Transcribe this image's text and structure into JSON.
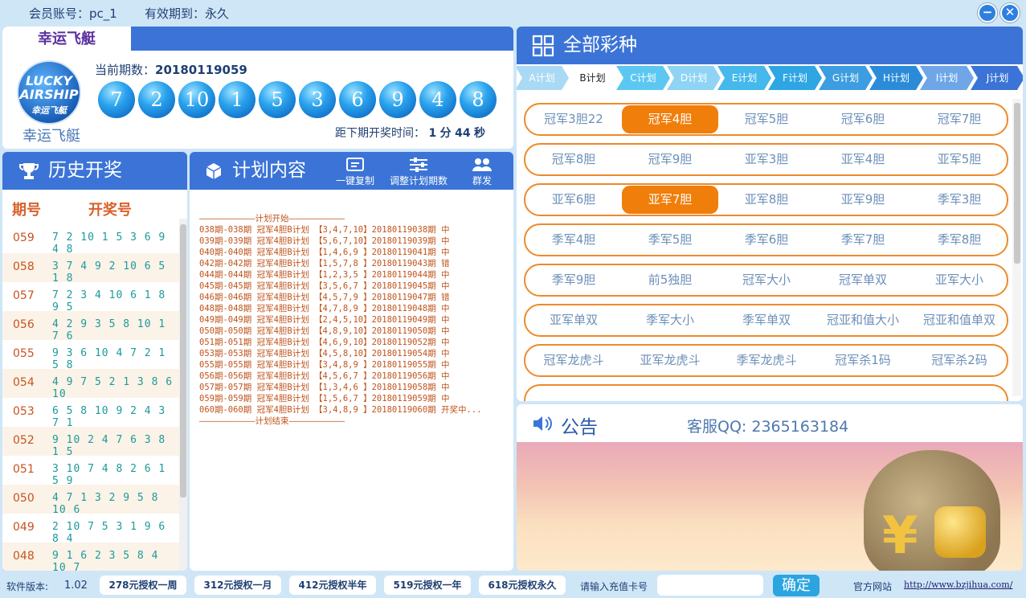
{
  "window": {
    "account_label": "会员账号：pc_1",
    "expiry_label": "有效期到：永久",
    "minimize": "−",
    "close": "✕"
  },
  "lottery": {
    "tab": "幸运飞艇",
    "logo_line1": "LUCKY",
    "logo_line2": "AIRSHIP",
    "logo_line3": "幸运飞艇",
    "logo_caption": "幸运飞艇",
    "period_label": "当前期数：",
    "period_value": "20180119059",
    "balls": [
      "7",
      "2",
      "10",
      "1",
      "5",
      "3",
      "6",
      "9",
      "4",
      "8"
    ],
    "countdown_label": "距下期开奖时间：",
    "countdown_min": "1",
    "countdown_min_unit": "分",
    "countdown_sec": "44",
    "countdown_sec_unit": "秒"
  },
  "history": {
    "title": "历史开奖",
    "col_period": "期号",
    "col_numbers": "开奖号",
    "rows": [
      {
        "period": "059",
        "numbers": "7 2 10 1 5 3 6 9 4 8"
      },
      {
        "period": "058",
        "numbers": "3 7 4 9 2 10 6 5 1 8"
      },
      {
        "period": "057",
        "numbers": "7 2 3 4 10 6 1 8 9 5"
      },
      {
        "period": "056",
        "numbers": "4 2 9 3 5 8 10 1 7 6"
      },
      {
        "period": "055",
        "numbers": "9 3 6 10 4 7 2 1 5 8"
      },
      {
        "period": "054",
        "numbers": "4 9 7 5 2 1 3 8 6 10"
      },
      {
        "period": "053",
        "numbers": "6 5 8 10 9 2 4 3 7 1"
      },
      {
        "period": "052",
        "numbers": "9 10 2 4 7 6 3 8 1 5"
      },
      {
        "period": "051",
        "numbers": "3 10 7 4 8 2 6 1 5 9"
      },
      {
        "period": "050",
        "numbers": "4 7 1 3 2 9 5 8 10 6"
      },
      {
        "period": "049",
        "numbers": "2 10 7 5 3 1 9 6 8 4"
      },
      {
        "period": "048",
        "numbers": "9 1 6 2 3 5 8 4 10 7"
      }
    ]
  },
  "plan": {
    "title": "计划内容",
    "tools": {
      "copy": "一键复制",
      "adjust": "调整计划期数",
      "group": "群发"
    },
    "lines": [
      "———————————计划开始———————————",
      "038期-038期 冠军4胆B计划 【3,4,7,10】20180119038期 中",
      "039期-039期 冠军4胆B计划 【5,6,7,10】20180119039期 中",
      "040期-040期 冠军4胆B计划 【1,4,6,9 】20180119041期 中",
      "042期-042期 冠军4胆B计划 【1,5,7,8 】20180119043期 错",
      "044期-044期 冠军4胆B计划 【1,2,3,5 】20180119044期 中",
      "045期-045期 冠军4胆B计划 【3,5,6,7 】20180119045期 中",
      "046期-046期 冠军4胆B计划 【4,5,7,9 】20180119047期 错",
      "048期-048期 冠军4胆B计划 【4,7,8,9 】20180119048期 中",
      "049期-049期 冠军4胆B计划 【2,4,5,10】20180119049期 中",
      "050期-050期 冠军4胆B计划 【4,8,9,10】20180119050期 中",
      "051期-051期 冠军4胆B计划 【4,6,9,10】20180119052期 中",
      "053期-053期 冠军4胆B计划 【4,5,8,10】20180119054期 中",
      "055期-055期 冠军4胆B计划 【3,4,8,9 】20180119055期 中",
      "056期-056期 冠军4胆B计划 【4,5,6,7 】20180119056期 中",
      "057期-057期 冠军4胆B计划 【1,3,4,6 】20180119058期 中",
      "059期-059期 冠军4胆B计划 【1,5,6,7 】20180119059期 中",
      "060期-060期 冠军4胆B计划 【3,4,8,9 】20180119060期 开奖中...",
      "———————————计划结束———————————"
    ]
  },
  "types": {
    "title": "全部彩种",
    "plans": [
      "A计划",
      "B计划",
      "C计划",
      "D计划",
      "E计划",
      "F计划",
      "G计划",
      "H计划",
      "I计划",
      "J计划"
    ],
    "active_plan": "B计划",
    "rows": [
      [
        "冠军3胆22",
        "冠军4胆",
        "冠军5胆",
        "冠军6胆",
        "冠军7胆"
      ],
      [
        "冠军8胆",
        "冠军9胆",
        "亚军3胆",
        "亚军4胆",
        "亚军5胆"
      ],
      [
        "亚军6胆",
        "亚军7胆",
        "亚军8胆",
        "亚军9胆",
        "季军3胆"
      ],
      [
        "季军4胆",
        "季军5胆",
        "季军6胆",
        "季军7胆",
        "季军8胆"
      ],
      [
        "季军9胆",
        "前5独胆",
        "冠军大小",
        "冠军单双",
        "亚军大小"
      ],
      [
        "亚军单双",
        "季军大小",
        "季军单双",
        "冠亚和值大小",
        "冠亚和值单双"
      ],
      [
        "冠军龙虎斗",
        "亚军龙虎斗",
        "季军龙虎斗",
        "冠军杀1码",
        "冠军杀2码"
      ]
    ],
    "selected": [
      "冠军4胆",
      "亚军7胆"
    ],
    "accent": "#f07e0a",
    "header_color": "#3b74d6"
  },
  "notice": {
    "title": "公告",
    "qq": "客服QQ: 2365163184"
  },
  "bottom": {
    "version_label": "软件版本:",
    "version": "1.02",
    "buttons": [
      "278元授权一周",
      "312元授权一月",
      "412元授权半年",
      "519元授权一年",
      "618元授权永久"
    ],
    "card_label": "请输入充值卡号",
    "card_value": "",
    "ok": "确定",
    "site_label": "官方网站",
    "url": "http://www.bzjihua.com/"
  }
}
